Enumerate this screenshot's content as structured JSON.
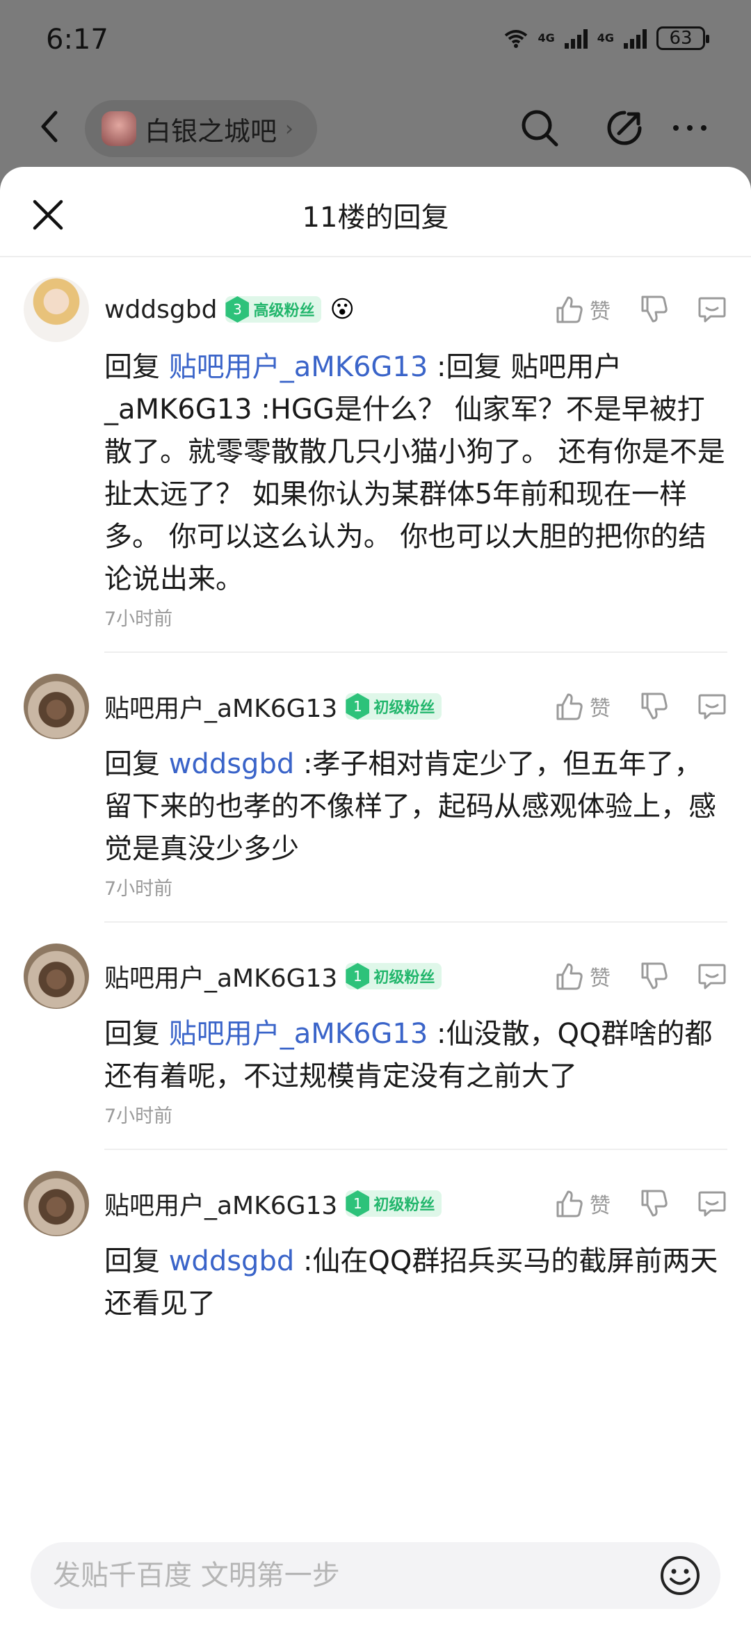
{
  "status": {
    "time": "6:17",
    "net1": "4G",
    "net2": "4G",
    "battery": "63"
  },
  "nav": {
    "forum_name": "白银之城吧"
  },
  "sheet": {
    "title": "11楼的回复"
  },
  "like_label": "赞",
  "replies": [
    {
      "username": "wddsgbd",
      "badge_level": "3",
      "badge_text": "高级粉丝",
      "emoji": "😮",
      "prefix": "回复",
      "mention": "贴吧用户_aMK6G13",
      "text": ":回复 贴吧用户_aMK6G13 :HGG是什么？ 仙家军？不是早被打散了。就零零散散几只小猫小狗了。 还有你是不是扯太远了？ 如果你认为某群体5年前和现在一样多。 你可以这么认为。 你也可以大胆的把你的结论说出来。",
      "time": "7小时前"
    },
    {
      "username": "贴吧用户_aMK6G13",
      "badge_level": "1",
      "badge_text": "初级粉丝",
      "prefix": "回复",
      "mention": "wddsgbd",
      "text": ":孝子相对肯定少了，但五年了，留下来的也孝的不像样了，起码从感观体验上，感觉是真没少多少",
      "time": "7小时前"
    },
    {
      "username": "贴吧用户_aMK6G13",
      "badge_level": "1",
      "badge_text": "初级粉丝",
      "prefix": "回复",
      "mention": "贴吧用户_aMK6G13",
      "text": ":仙没散，QQ群啥的都还有着呢，不过规模肯定没有之前大了",
      "time": "7小时前"
    },
    {
      "username": "贴吧用户_aMK6G13",
      "badge_level": "1",
      "badge_text": "初级粉丝",
      "prefix": "回复",
      "mention": "wddsgbd",
      "text": ":仙在QQ群招兵买马的截屏前两天还看见了",
      "time": ""
    }
  ],
  "composer": {
    "placeholder": "发贴千百度 文明第一步"
  },
  "colors": {
    "mention": "#3a64c9",
    "badge_green": "#2dc27a",
    "badge_bg": "#dff7e9"
  },
  "icons": [
    "back-icon",
    "search-icon",
    "share-icon",
    "more-icon",
    "close-icon",
    "thumb-up-icon",
    "thumb-down-icon",
    "comment-icon",
    "emoji-icon"
  ]
}
